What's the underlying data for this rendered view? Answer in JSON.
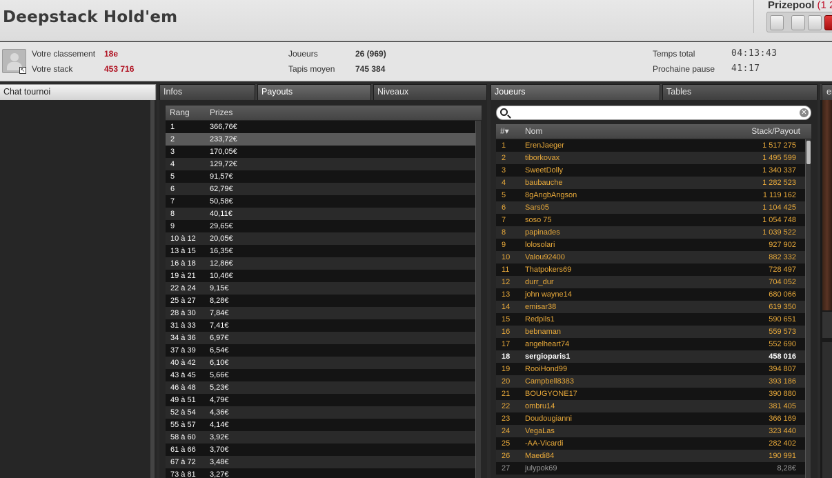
{
  "header": {
    "title": "Deepstack Hold'em",
    "prizepool_label": "Prizepool",
    "prizepool_value": "(1 2"
  },
  "info": {
    "rank_label": "Votre classement",
    "rank_value": "18e",
    "stack_label": "Votre stack",
    "stack_value": "453 716",
    "players_label": "Joueurs",
    "players_value": "26 (969)",
    "avg_label": "Tapis moyen",
    "avg_value": "745 384",
    "total_time_label": "Temps total",
    "total_time_value": "04:13:43",
    "next_break_label": "Prochaine pause",
    "next_break_value": "41:17"
  },
  "tabs": {
    "chat": "Chat tournoi",
    "infos": "Infos",
    "payouts": "Payouts",
    "niveaux": "Niveaux",
    "joueurs": "Joueurs",
    "tables": "Tables",
    "edge": "er"
  },
  "payouts": {
    "col_rank": "Rang",
    "col_prize": "Prizes",
    "rows": [
      [
        "1",
        "366,76€"
      ],
      [
        "2",
        "233,72€"
      ],
      [
        "3",
        "170,05€"
      ],
      [
        "4",
        "129,72€"
      ],
      [
        "5",
        "91,57€"
      ],
      [
        "6",
        "62,79€"
      ],
      [
        "7",
        "50,58€"
      ],
      [
        "8",
        "40,11€"
      ],
      [
        "9",
        "29,65€"
      ],
      [
        "10 à 12",
        "20,05€"
      ],
      [
        "13 à 15",
        "16,35€"
      ],
      [
        "16 à 18",
        "12,86€"
      ],
      [
        "19 à 21",
        "10,46€"
      ],
      [
        "22 à 24",
        "9,15€"
      ],
      [
        "25 à 27",
        "8,28€"
      ],
      [
        "28 à 30",
        "7,84€"
      ],
      [
        "31 à 33",
        "7,41€"
      ],
      [
        "34 à 36",
        "6,97€"
      ],
      [
        "37 à 39",
        "6,54€"
      ],
      [
        "40 à 42",
        "6,10€"
      ],
      [
        "43 à 45",
        "5,66€"
      ],
      [
        "46 à 48",
        "5,23€"
      ],
      [
        "49 à 51",
        "4,79€"
      ],
      [
        "52 à 54",
        "4,36€"
      ],
      [
        "55 à 57",
        "4,14€"
      ],
      [
        "58 à 60",
        "3,92€"
      ],
      [
        "61 à 66",
        "3,70€"
      ],
      [
        "67 à 72",
        "3,48€"
      ],
      [
        "73 à 81",
        "3,27€"
      ]
    ],
    "selected_index": 1
  },
  "players": {
    "search_placeholder": "",
    "col_num": "#▾",
    "col_name": "Nom",
    "col_stack": "Stack/Payout",
    "rows": [
      [
        "1",
        "ErenJaeger",
        "1 517 275"
      ],
      [
        "2",
        "tiborkovax",
        "1 495 599"
      ],
      [
        "3",
        "SweetDolly",
        "1 340 337"
      ],
      [
        "4",
        "baubauche",
        "1 282 523"
      ],
      [
        "5",
        "8gAngbAngson",
        "1 119 162"
      ],
      [
        "6",
        "Sars05",
        "1 104 425"
      ],
      [
        "7",
        "soso 75",
        "1 054 748"
      ],
      [
        "8",
        "papinades",
        "1 039 522"
      ],
      [
        "9",
        "lolosolari",
        "927 902"
      ],
      [
        "10",
        "Valou92400",
        "882 332"
      ],
      [
        "11",
        "Thatpokers69",
        "728 497"
      ],
      [
        "12",
        "durr_dur",
        "704 052"
      ],
      [
        "13",
        "john wayne14",
        "680 066"
      ],
      [
        "14",
        "emisar38",
        "619 350"
      ],
      [
        "15",
        "Redpils1",
        "590 651"
      ],
      [
        "16",
        "bebnaman",
        "559 573"
      ],
      [
        "17",
        "angelheart74",
        "552 690"
      ],
      [
        "18",
        "sergioparis1",
        "458 016"
      ],
      [
        "19",
        "RooiHond99",
        "394 807"
      ],
      [
        "20",
        "Campbell8383",
        "393 186"
      ],
      [
        "21",
        "BOUGYONE17",
        "390 880"
      ],
      [
        "22",
        "ombru14",
        "381 405"
      ],
      [
        "23",
        "Doudougianni",
        "366 169"
      ],
      [
        "24",
        "VegaLas",
        "323 440"
      ],
      [
        "25",
        "-AA-Vicardi",
        "282 402"
      ],
      [
        "26",
        "Maedi84",
        "190 991"
      ],
      [
        "27",
        "julypok69",
        "8,28€"
      ]
    ],
    "me_index": 17,
    "eliminated_from": 26
  },
  "colors": {
    "accent_red": "#b01020",
    "player_gold": "#e8a93a",
    "eliminated_grey": "#9a9a9a"
  }
}
